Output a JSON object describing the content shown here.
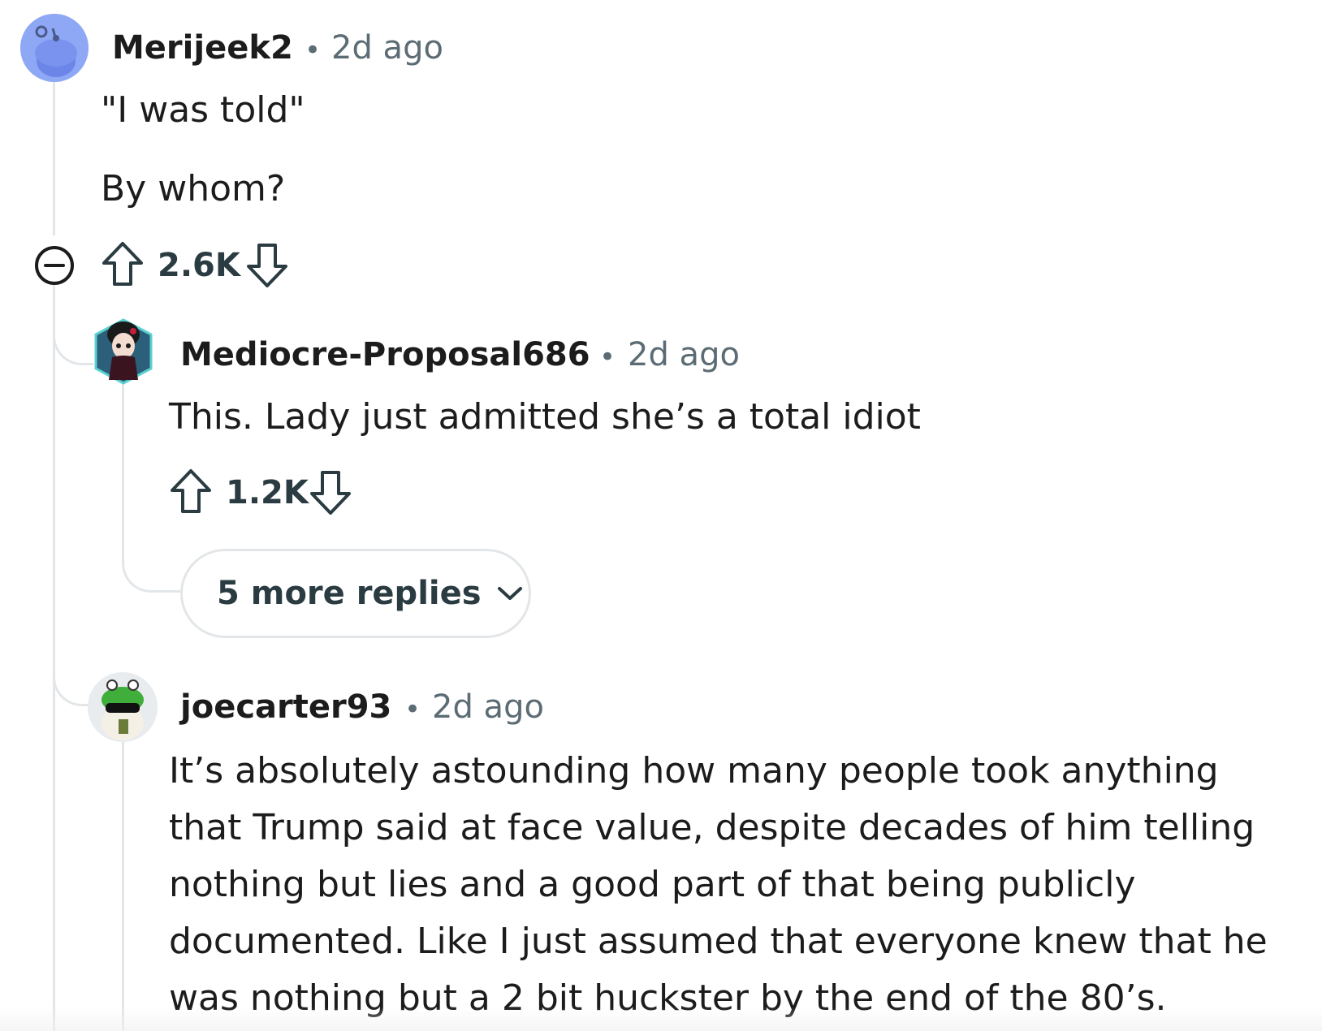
{
  "comments": [
    {
      "author": "Merijeek2",
      "separator": "•",
      "time": "2d ago",
      "body": [
        "\"I was told\"",
        "By whom?"
      ],
      "score": "2.6K",
      "avatar_icon": "snoo-default-avatar-icon",
      "avatar_color": "#8fa8f5"
    },
    {
      "author": "Mediocre-Proposal686",
      "separator": "•",
      "time": "2d ago",
      "body": [
        "This. Lady just admitted she’s a total idiot"
      ],
      "score": "1.2K",
      "avatar_icon": "gothic-doll-avatar-icon",
      "more_replies": "5 more replies"
    },
    {
      "author": "joecarter93",
      "separator": "•",
      "time": "2d ago",
      "body": [
        "It’s absolutely astounding how many people took anything",
        "that Trump said at face value, despite decades of him telling",
        "nothing but lies and a good part of that being publicly",
        "documented. Like I just assumed that everyone knew that he",
        "was nothing but a 2 bit huckster by the end of the 80’s."
      ],
      "avatar_icon": "frog-hat-avatar-icon"
    }
  ],
  "colors": {
    "thread_line": "#e3e6e8",
    "meta_text": "#5c6c74",
    "score_text": "#2a3c42"
  }
}
